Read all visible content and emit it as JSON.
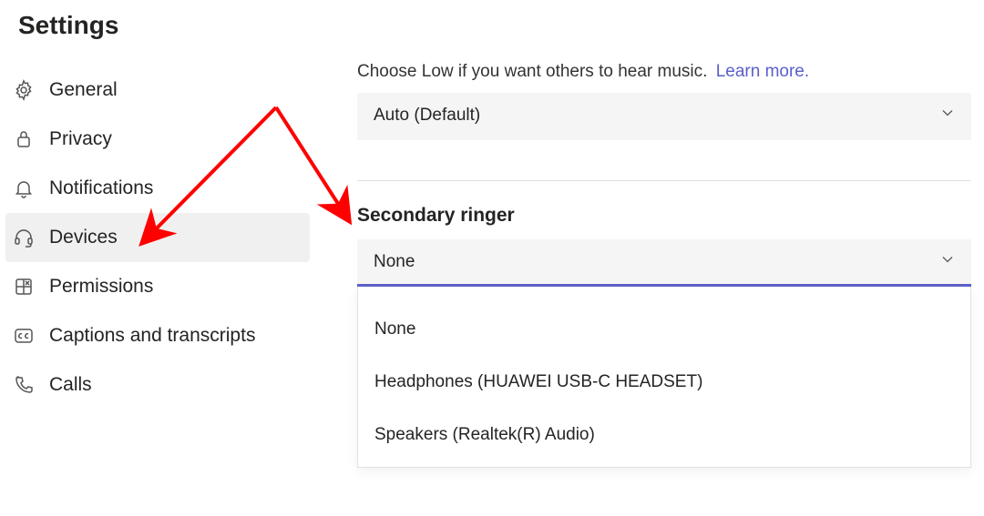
{
  "page_title": "Settings",
  "sidebar": {
    "items": [
      {
        "label": "General",
        "icon": "gear-icon"
      },
      {
        "label": "Privacy",
        "icon": "lock-icon"
      },
      {
        "label": "Notifications",
        "icon": "bell-icon"
      },
      {
        "label": "Devices",
        "icon": "headset-icon",
        "selected": true
      },
      {
        "label": "Permissions",
        "icon": "app-grid-icon"
      },
      {
        "label": "Captions and transcripts",
        "icon": "cc-icon"
      },
      {
        "label": "Calls",
        "icon": "phone-icon"
      }
    ]
  },
  "main": {
    "hint_text": "Choose Low if you want others to hear music.",
    "learn_more": "Learn more.",
    "audio_mode_select": {
      "value": "Auto (Default)"
    },
    "secondary_ringer": {
      "label": "Secondary ringer",
      "value": "None",
      "options": [
        "None",
        "Headphones (HUAWEI USB-C HEADSET)",
        "Speakers (Realtek(R) Audio)"
      ]
    }
  },
  "annotation": {
    "arrow_color": "#ff0000"
  }
}
